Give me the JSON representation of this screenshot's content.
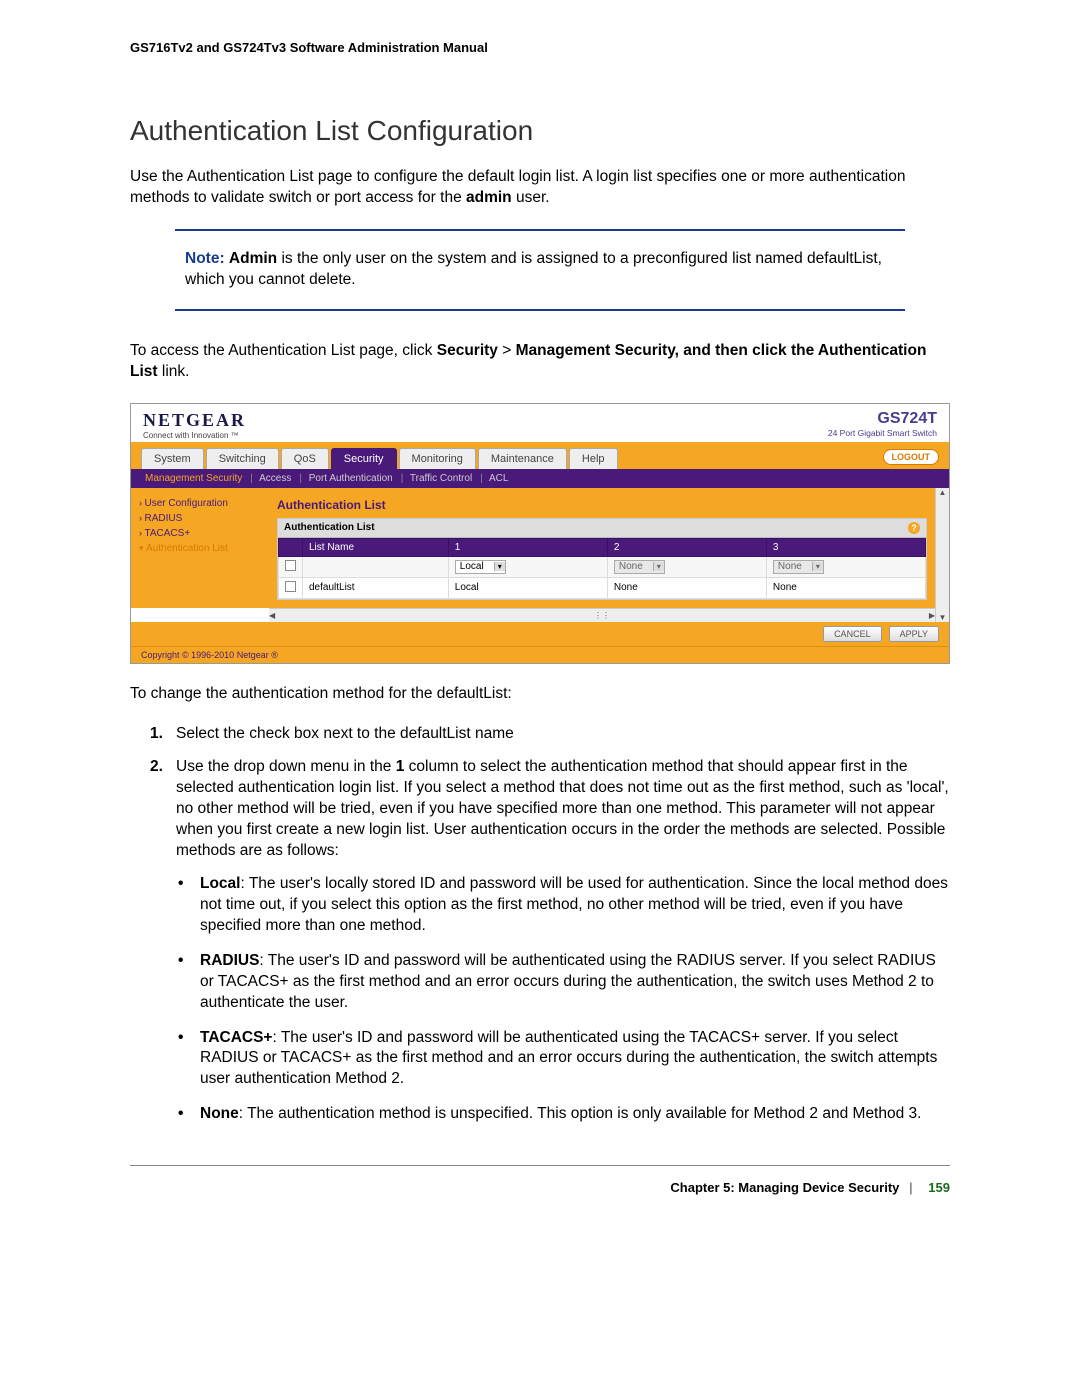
{
  "header": {
    "manual_title": "GS716Tv2 and GS724Tv3 Software Administration Manual"
  },
  "section": {
    "heading": "Authentication List Configuration",
    "intro_before_admin": "Use the Authentication List page to configure the default login list. A login list specifies one or more authentication methods to validate switch or port access for the ",
    "admin_word": "admin",
    "intro_after_admin": " user."
  },
  "note": {
    "label": "Note:",
    "bold1": "Admin",
    "text": " is the only user on the system and is assigned to a preconfigured list named defaultList, which you cannot delete."
  },
  "access": {
    "pre": "To access the Authentication List page, click ",
    "path1": "Security",
    "gt": ">",
    "path2": "Management Security, and then click the Authentication List",
    "post": " link."
  },
  "screenshot": {
    "logo": "NETGEAR",
    "tagline": "Connect with Innovation ™",
    "product_name": "GS724T",
    "product_desc": "24 Port Gigabit Smart Switch",
    "tabs": [
      "System",
      "Switching",
      "QoS",
      "Security",
      "Monitoring",
      "Maintenance",
      "Help"
    ],
    "active_tab_index": 3,
    "logout": "LOGOUT",
    "subtabs": [
      "Management Security",
      "Access",
      "Port Authentication",
      "Traffic Control",
      "ACL"
    ],
    "sub_active_index": 0,
    "side_items": [
      "User Configuration",
      "RADIUS",
      "TACACS+",
      "Authentication List"
    ],
    "side_active_index": 3,
    "main_title": "Authentication List",
    "panel_title": "Authentication List",
    "help_glyph": "?",
    "columns": [
      "",
      "List Name",
      "1",
      "2",
      "3"
    ],
    "row_input": {
      "name": "",
      "c1": "Local",
      "c2": "None",
      "c3": "None"
    },
    "row_data": {
      "name": "defaultList",
      "c1": "Local",
      "c2": "None",
      "c3": "None"
    },
    "btn_cancel": "CANCEL",
    "btn_apply": "APPLY",
    "copyright": "Copyright © 1996-2010 Netgear ®"
  },
  "instructions": {
    "lead": "To change the authentication method for the defaultList:",
    "steps": [
      {
        "num": "1.",
        "text": "Select the check box next to the defaultList name"
      },
      {
        "num": "2.",
        "pre": "Use the drop down menu in the ",
        "bold": "1",
        "post": " column to select the authentication method that should appear first in the selected authentication login list. If you select a method that does not time out as the first method, such as 'local', no other method will be tried, even if you have specified more than one method. This parameter will not appear when you first create a new login list. User authentication occurs in the order the methods are selected. Possible methods are as follows:"
      }
    ],
    "bullets": [
      {
        "label": "Local",
        "text": ": The user's locally stored ID and password will be used for authentication. Since the local method does not time out, if you select this option as the first method, no other method will be tried, even if you have specified more than one method."
      },
      {
        "label": "RADIUS",
        "text": ": The user's ID and password will be authenticated using the RADIUS server. If you select RADIUS or TACACS+ as the first method and an error occurs during the authentication, the switch uses Method 2 to authenticate the user."
      },
      {
        "label": "TACACS+",
        "text": ": The user's ID and password will be authenticated using the TACACS+ server. If you select RADIUS or TACACS+ as the first method and an error occurs during the authentication, the switch attempts user authentication Method 2."
      },
      {
        "label": "None",
        "text": ": The authentication method is unspecified. This option is only available for Method 2 and Method 3."
      }
    ]
  },
  "footer": {
    "chapter": "Chapter 5:  Managing Device Security",
    "page": "159"
  }
}
